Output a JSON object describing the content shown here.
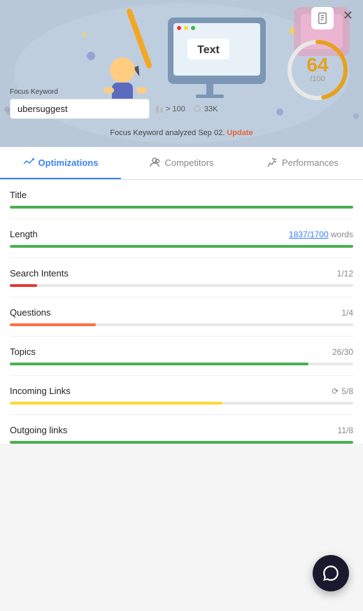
{
  "hero": {
    "focus_keyword_label": "Focus Keyword",
    "focus_keyword_value": "ubersuggest",
    "analyzed_text": "Focus Keyword analyzed Sep 02.",
    "update_label": "Update",
    "score": "64",
    "score_denom": "/100",
    "kw_difficulty": "> 100",
    "kw_volume": "33K"
  },
  "tabs": [
    {
      "id": "optimizations",
      "label": "Optimizations",
      "active": true
    },
    {
      "id": "competitors",
      "label": "Competitors",
      "active": false
    },
    {
      "id": "performances",
      "label": "Performances",
      "active": false
    }
  ],
  "metrics": [
    {
      "name": "Title",
      "value": "",
      "progress": 100,
      "color": "#4caf50"
    },
    {
      "name": "Length",
      "value": "1837/1700 words",
      "value_link": "1837/1700",
      "value_suffix": "words",
      "progress": 100,
      "color": "#4caf50"
    },
    {
      "name": "Search Intents",
      "value": "1/12",
      "progress": 8,
      "color": "#e53935"
    },
    {
      "name": "Questions",
      "value": "1/4",
      "progress": 25,
      "color": "#ff7043"
    },
    {
      "name": "Topics",
      "value": "26/30",
      "progress": 87,
      "color": "#4caf50"
    },
    {
      "name": "Incoming Links",
      "value": "5/8",
      "has_refresh": true,
      "progress": 62,
      "color": "#fdd835"
    },
    {
      "name": "Outgoing links",
      "value": "11/8",
      "progress": 100,
      "color": "#4caf50"
    }
  ],
  "chat_button": {
    "label": "Chat"
  }
}
